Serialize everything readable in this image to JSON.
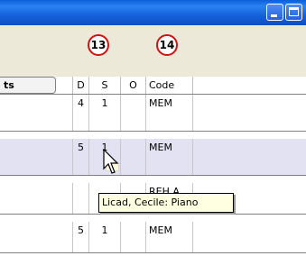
{
  "callouts": {
    "first": "13",
    "second": "14"
  },
  "grid": {
    "header_tab_label": "ts",
    "columns": {
      "d": "D",
      "s": "S",
      "o": "O",
      "code": "Code"
    },
    "rows": [
      {
        "d": "4",
        "s": "1",
        "o": "",
        "code": "MEM"
      },
      {
        "d": "5",
        "s": "1",
        "o": "",
        "code": "MEM"
      },
      {
        "d": "",
        "s": "",
        "o": "",
        "code": "REH A"
      },
      {
        "d": "5",
        "s": "1",
        "o": "",
        "code": "MEM"
      }
    ]
  },
  "tooltip": {
    "text": "Licad, Cecile: Piano"
  },
  "colors": {
    "titlebar_blue": "#1562dc",
    "callout_red": "#d41010",
    "selected_row": "#e3e2f2",
    "tooltip_bg": "#ffffe1"
  }
}
